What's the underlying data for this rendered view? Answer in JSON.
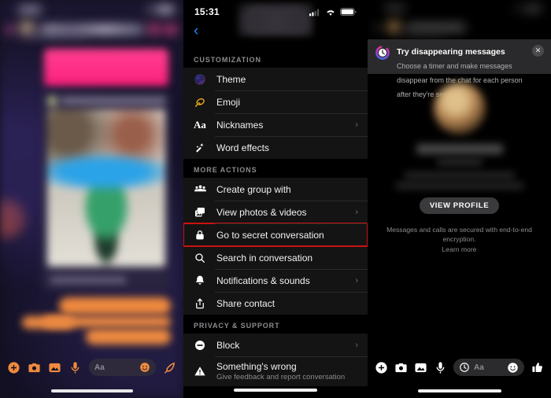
{
  "left_panel": {
    "name": "messenger-chat-blurred",
    "status_bar": {
      "time": "",
      "blurred": true
    },
    "theme_accent": "#f08a3e",
    "composer": {
      "placeholder": "Aa",
      "icons": [
        "plus-icon",
        "camera-icon",
        "image-icon",
        "microphone-icon",
        "emoji-icon",
        "sticker-icon"
      ]
    }
  },
  "middle_panel": {
    "name": "chat-details-menu",
    "status_bar": {
      "time": "15:31",
      "signal": "signal-icon",
      "wifi": "wifi-icon",
      "battery": "battery-icon"
    },
    "back_label": "‹",
    "sections": [
      {
        "header": "CUSTOMIZATION",
        "items": [
          {
            "icon": "theme-icon",
            "label": "Theme",
            "chevron": false,
            "sub": ""
          },
          {
            "icon": "emoji-icon",
            "label": "Emoji",
            "chevron": false,
            "sub": ""
          },
          {
            "icon": "nicknames-aa-icon",
            "label": "Nicknames",
            "chevron": true,
            "sub": ""
          },
          {
            "icon": "word-effects-icon",
            "label": "Word effects",
            "chevron": false,
            "sub": ""
          }
        ]
      },
      {
        "header": "MORE ACTIONS",
        "items": [
          {
            "icon": "people-group-icon",
            "label": "Create group with",
            "chevron": false,
            "sub": ""
          },
          {
            "icon": "photo-stack-icon",
            "label": "View photos & videos",
            "chevron": true,
            "sub": ""
          },
          {
            "icon": "lock-icon",
            "label": "Go to secret conversation",
            "chevron": false,
            "sub": "",
            "highlighted": true
          },
          {
            "icon": "search-icon",
            "label": "Search in conversation",
            "chevron": false,
            "sub": ""
          },
          {
            "icon": "bell-icon",
            "label": "Notifications & sounds",
            "chevron": true,
            "sub": ""
          },
          {
            "icon": "share-icon",
            "label": "Share contact",
            "chevron": false,
            "sub": ""
          }
        ]
      },
      {
        "header": "PRIVACY & SUPPORT",
        "items": [
          {
            "icon": "block-icon",
            "label": "Block",
            "chevron": true,
            "sub": ""
          },
          {
            "icon": "warning-icon",
            "label": "Something's wrong",
            "chevron": false,
            "sub": "Give feedback and report conversation"
          }
        ]
      }
    ],
    "highlight_color": "#cc1111"
  },
  "right_panel": {
    "name": "chat-thread-with-banner",
    "banner": {
      "icon": "disappearing-clock-icon",
      "title": "Try disappearing messages",
      "description": "Choose a timer and make messages disappear from the chat for each person after they're seen.",
      "close_label": "✕"
    },
    "profile": {
      "view_profile_label": "VIEW PROFILE",
      "encryption_note": "Messages and calls are secured with end-to-end encryption.",
      "learn_more_label": "Learn more"
    },
    "composer": {
      "placeholder": "Aa",
      "timer_icon": "clock-icon",
      "icons": [
        "plus-icon",
        "camera-icon",
        "image-icon",
        "microphone-icon",
        "emoji-icon",
        "thumbs-up-icon"
      ]
    }
  }
}
